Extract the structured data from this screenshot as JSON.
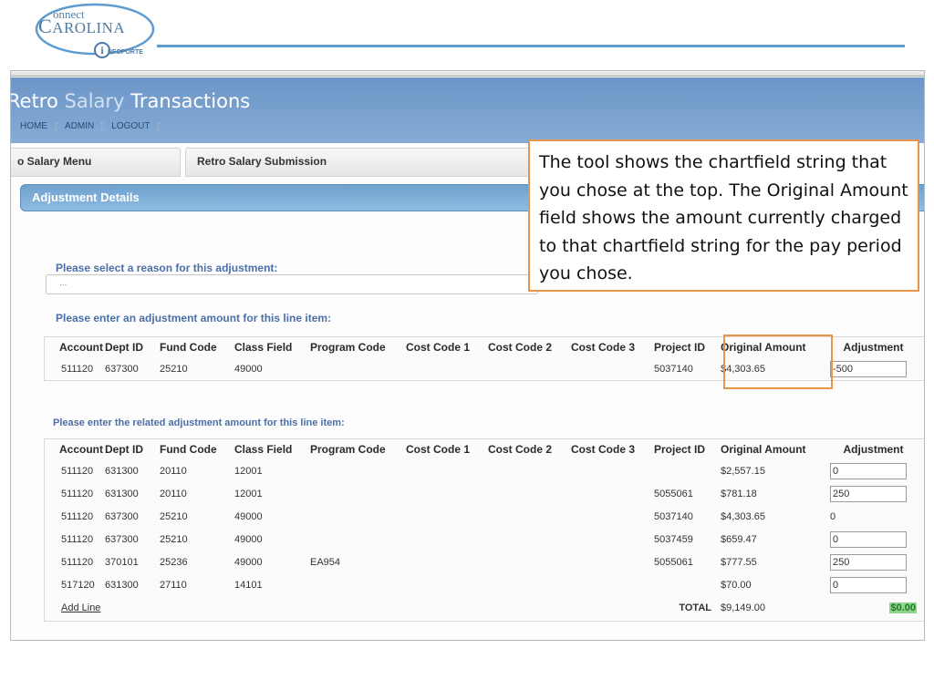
{
  "logo": {
    "connect": "onnect",
    "carolina": "AROLINA",
    "initial": "C",
    "infoporte_i": "i",
    "infoporte": "NFOPORTE"
  },
  "app": {
    "title_parts": [
      "Retro ",
      "Salary",
      " Transactions"
    ],
    "nav": [
      "HOME",
      "ADMIN",
      "LOGOUT"
    ]
  },
  "tabs": [
    {
      "label": "o Salary Menu"
    },
    {
      "label": "Retro Salary Submission"
    }
  ],
  "panel": {
    "title": "Adjustment Details",
    "reason_label": "Please select a reason for this adjustment:",
    "reason_value": "...",
    "line_item_label": "Please enter an adjustment amount for this line item:",
    "related_label": "Please enter the related adjustment amount for this line item:"
  },
  "columns": [
    "Account",
    "Dept ID",
    "Fund Code",
    "Class Field",
    "Program Code",
    "Cost Code 1",
    "Cost Code 2",
    "Cost Code 3",
    "Project ID",
    "Original Amount",
    "Adjustment"
  ],
  "line_item": {
    "account": "511120",
    "dept_id": "637300",
    "fund_code": "25210",
    "class_field": "49000",
    "program_code": "",
    "cost_code_1": "",
    "cost_code_2": "",
    "cost_code_3": "",
    "project_id": "5037140",
    "original_amount": "$4,303.65",
    "adjustment": "-500"
  },
  "related_items": [
    {
      "account": "511120",
      "dept_id": "631300",
      "fund_code": "20110",
      "class_field": "12001",
      "program_code": "",
      "project_id": "",
      "original_amount": "$2,557.15",
      "adjustment": "0",
      "editable": true
    },
    {
      "account": "511120",
      "dept_id": "631300",
      "fund_code": "20110",
      "class_field": "12001",
      "program_code": "",
      "project_id": "5055061",
      "original_amount": "$781.18",
      "adjustment": "250",
      "editable": true
    },
    {
      "account": "511120",
      "dept_id": "637300",
      "fund_code": "25210",
      "class_field": "49000",
      "program_code": "",
      "project_id": "5037140",
      "original_amount": "$4,303.65",
      "adjustment": "0",
      "editable": false
    },
    {
      "account": "511120",
      "dept_id": "637300",
      "fund_code": "25210",
      "class_field": "49000",
      "program_code": "",
      "project_id": "5037459",
      "original_amount": "$659.47",
      "adjustment": "0",
      "editable": true
    },
    {
      "account": "511120",
      "dept_id": "370101",
      "fund_code": "25236",
      "class_field": "49000",
      "program_code": "EA954",
      "project_id": "5055061",
      "original_amount": "$777.55",
      "adjustment": "250",
      "editable": true
    },
    {
      "account": "517120",
      "dept_id": "631300",
      "fund_code": "27110",
      "class_field": "14101",
      "program_code": "",
      "project_id": "",
      "original_amount": "$70.00",
      "adjustment": "0",
      "editable": true
    }
  ],
  "totals": {
    "add_line": "Add Line",
    "label": "TOTAL",
    "original_amount": "$9,149.00",
    "adjustment": "$0.00",
    "adjustment_color": "#8fd48f"
  },
  "callout": {
    "text": "The tool shows the chartfield string that you chose at the top. The Original Amount field shows the amount currently charged to that chartfield string for the pay period you chose.",
    "border_color": "#e8954a"
  }
}
